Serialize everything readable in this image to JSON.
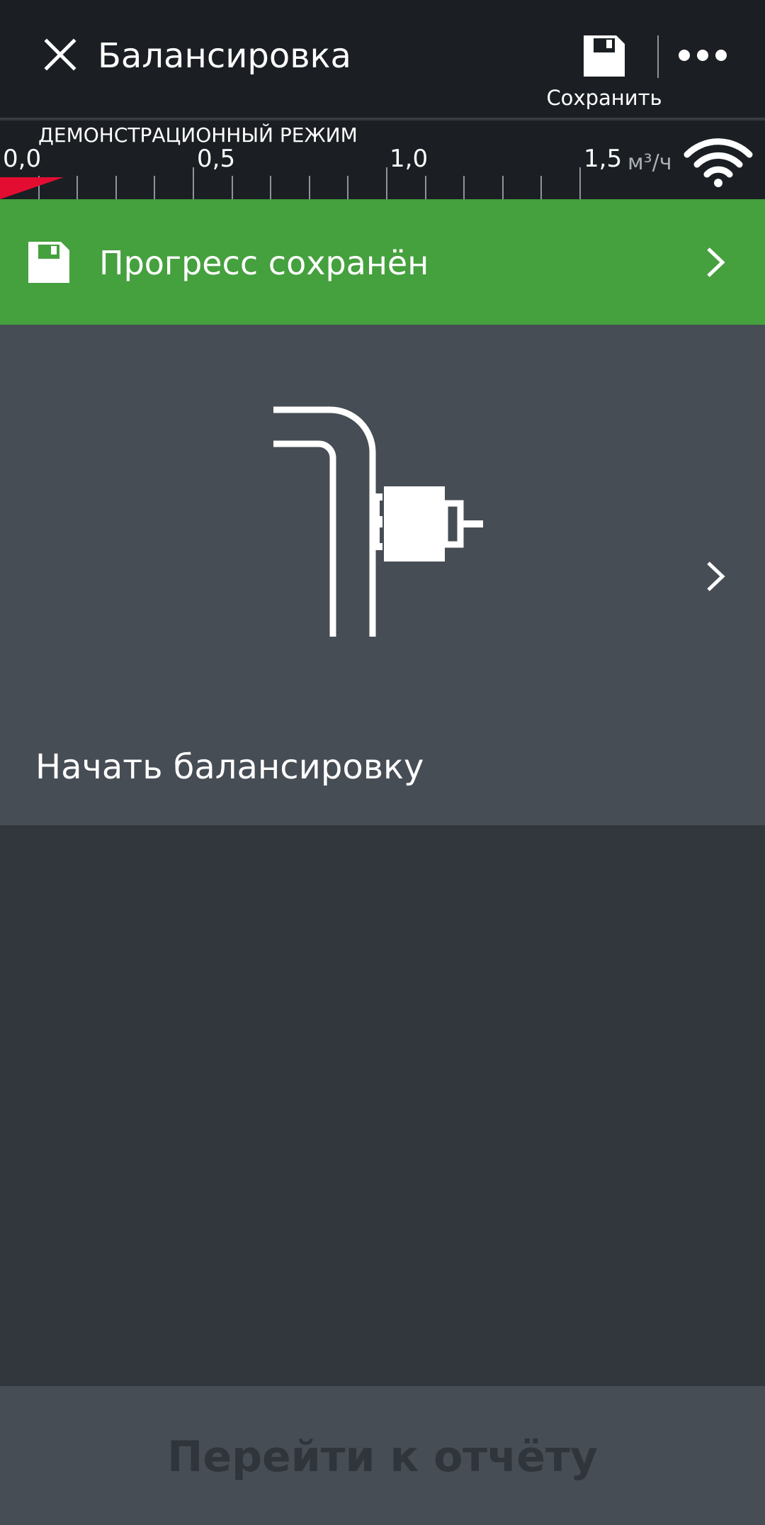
{
  "header": {
    "title": "Балансировка",
    "close_icon": "close-icon",
    "save_label": "Сохранить",
    "save_icon": "floppy-disk-icon",
    "more_icon": "more-horizontal-icon"
  },
  "scale": {
    "mode_label": "ДЕМОНСТРАЦИОННЫЙ РЕЖИМ",
    "tick_labels": [
      "0,0",
      "0,5",
      "1,0",
      "1,5"
    ],
    "unit": "м³/ч",
    "current_flow": 0.12,
    "wifi_icon": "wifi-icon"
  },
  "banner": {
    "text": "Прогресс сохранён",
    "icon": "floppy-disk-icon",
    "color": "#45a03e"
  },
  "card": {
    "label": "Начать балансировку",
    "illustration": "pipe-valve-icon"
  },
  "footer": {
    "report_button": "Перейти к отчёту"
  },
  "colors": {
    "background": "#32373e",
    "topbar": "#1b1f23",
    "card": "#474d54",
    "indicator": "#e30d32"
  }
}
